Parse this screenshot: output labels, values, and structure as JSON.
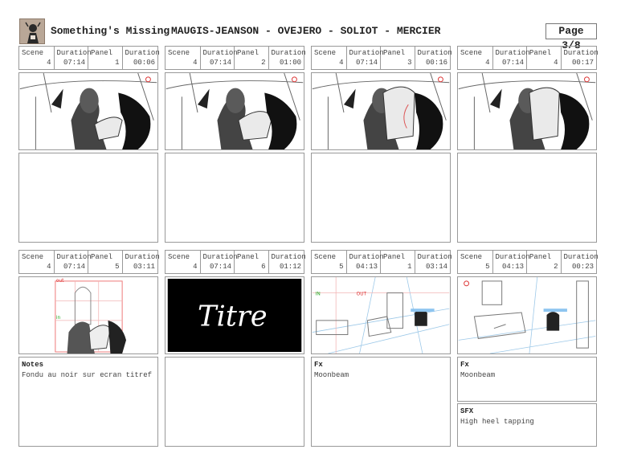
{
  "header": {
    "title": "Something's Missing",
    "authors": "MAUGIS-JEANSON - OVEJERO - SOLIOT - MERCIER",
    "page": "Page 3/8"
  },
  "labels": {
    "scene": "Scene",
    "duration": "Duration",
    "panel": "Panel"
  },
  "panels": [
    {
      "scene": "4",
      "scene_duration": "07:14",
      "panel": "1",
      "duration": "00:06",
      "image": "vampire-reading-letter-sketch"
    },
    {
      "scene": "4",
      "scene_duration": "07:14",
      "panel": "2",
      "duration": "01:00",
      "image": "vampire-reading-letter-sketch"
    },
    {
      "scene": "4",
      "scene_duration": "07:14",
      "panel": "3",
      "duration": "00:16",
      "image": "vampire-reading-letter-sketch",
      "annotation": "O"
    },
    {
      "scene": "4",
      "scene_duration": "07:14",
      "panel": "4",
      "duration": "00:17",
      "image": "vampire-reading-letter-sketch"
    },
    {
      "scene": "4",
      "scene_duration": "07:14",
      "panel": "5",
      "duration": "03:11",
      "image": "vampire-layout-sketch",
      "tags": [
        "out",
        "in"
      ],
      "note_label": "Notes",
      "note_text": "Fondu au noir sur ecran titref"
    },
    {
      "scene": "4",
      "scene_duration": "07:14",
      "panel": "6",
      "duration": "01:12",
      "image": "title-card",
      "frame_text": "Titre"
    },
    {
      "scene": "5",
      "scene_duration": "04:13",
      "panel": "1",
      "duration": "03:14",
      "image": "bedroom-perspective-layout",
      "tags": [
        "IN",
        "OUT"
      ],
      "note_label": "Fx",
      "note_text": "Moonbeam"
    },
    {
      "scene": "5",
      "scene_duration": "04:13",
      "panel": "2",
      "duration": "00:23",
      "image": "bedroom-perspective-layout",
      "note_label": "Fx",
      "note_text": "Moonbeam",
      "sfx_label": "SFX",
      "sfx_text": "High heel tapping"
    }
  ]
}
